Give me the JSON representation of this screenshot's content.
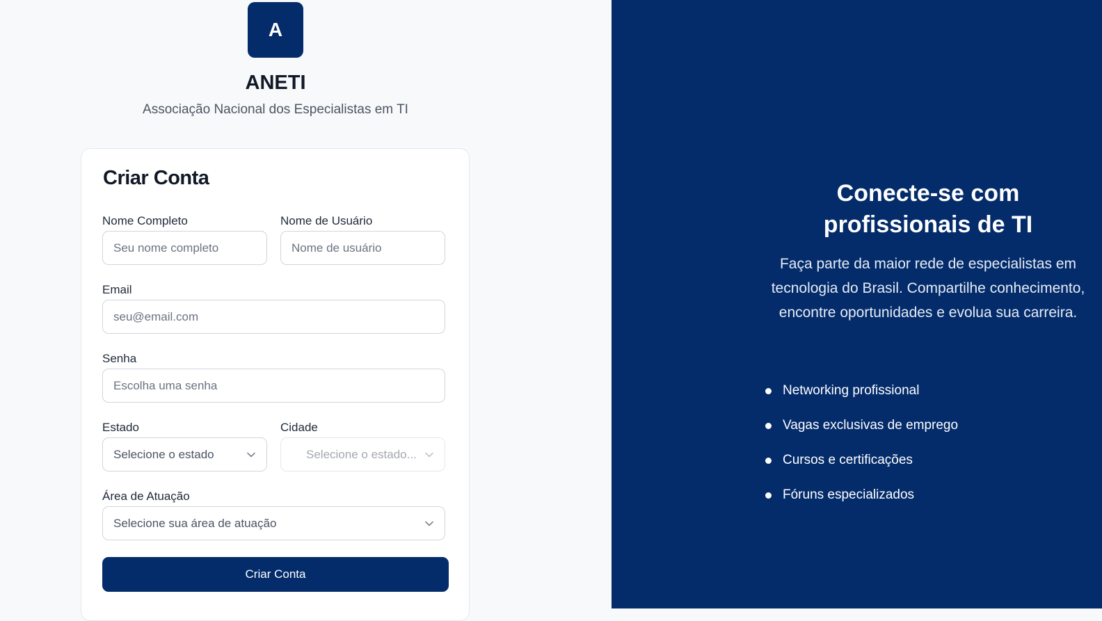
{
  "brand": {
    "logo_letter": "A",
    "name": "ANETI",
    "subtitle": "Associação Nacional dos Especialistas em TI"
  },
  "form": {
    "title": "Criar Conta",
    "fields": {
      "full_name": {
        "label": "Nome Completo",
        "placeholder": "Seu nome completo",
        "value": ""
      },
      "username": {
        "label": "Nome de Usuário",
        "placeholder": "Nome de usuário",
        "value": ""
      },
      "email": {
        "label": "Email",
        "placeholder": "seu@email.com",
        "value": ""
      },
      "password": {
        "label": "Senha",
        "placeholder": "Escolha uma senha",
        "value": ""
      },
      "state": {
        "label": "Estado",
        "selected": "Selecione o estado"
      },
      "city": {
        "label": "Cidade",
        "selected": "Selecione o estado...",
        "disabled": true
      },
      "area": {
        "label": "Área de Atuação",
        "selected": "Selecione sua área de atuação"
      }
    },
    "submit_label": "Criar Conta"
  },
  "hero": {
    "title": "Conecte-se com profissionais de TI",
    "description": "Faça parte da maior rede de especialistas em tecnologia do Brasil. Compartilhe conhecimento, encontre oportunidades e evolua sua carreira.",
    "features": [
      "Networking profissional",
      "Vagas exclusivas de emprego",
      "Cursos e certificações",
      "Fóruns especializados"
    ]
  },
  "colors": {
    "primary": "#042c6b",
    "page_background": "#f8f9fa",
    "card_background": "#ffffff",
    "border": "#d1d5db"
  },
  "icons": {
    "select_arrow": "chevron-down-icon",
    "feature_bullet": "bullet-dot-icon"
  }
}
